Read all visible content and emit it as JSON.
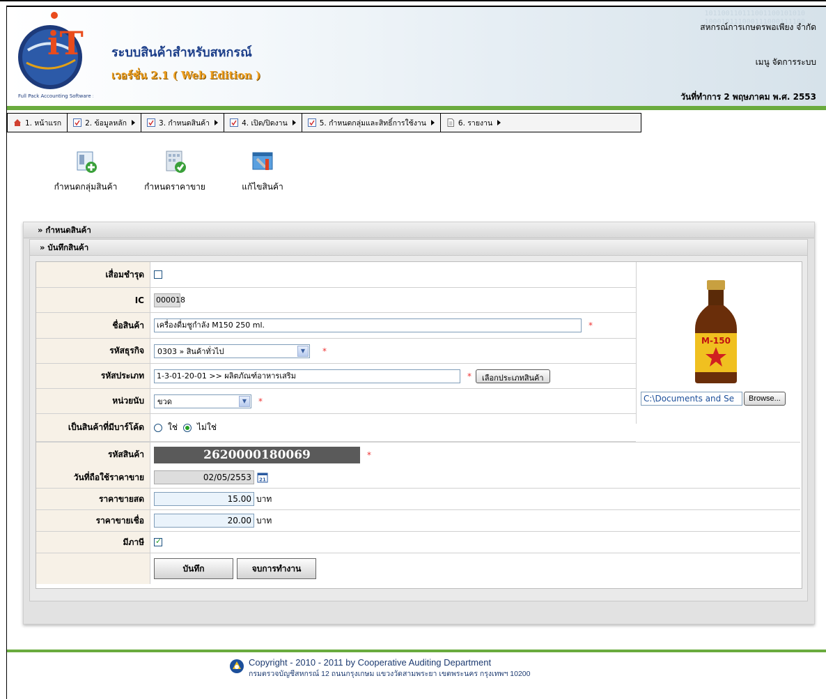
{
  "header": {
    "system_title": "ระบบสินค้าสำหรับสหกรณ์",
    "version": "เวอร์ชั่น 2.1 ( Web Edition )",
    "logo_text": "Full Pack Accounting Software : FAS",
    "coop_name": "สหกรณ์การเกษตรพอเพียง จำกัด",
    "admin_menu": "เมนู จัดการระบบ",
    "working_date": "วันที่ทำการ 2 พฤษภาคม พ.ศ. 2553",
    "binary_text": [
      "101100110111001100101010",
      "100010111000111000111100",
      "10001000111000"
    ]
  },
  "menu": [
    {
      "label": "1. หน้าแรก",
      "icon": "home-icon",
      "arrow": false
    },
    {
      "label": "2. ข้อมูลหลัก",
      "icon": "checklist-icon",
      "arrow": true
    },
    {
      "label": "3. กำหนดสินค้า",
      "icon": "checklist-icon",
      "arrow": true
    },
    {
      "label": "4. เปิด/ปิดงาน",
      "icon": "checklist-icon",
      "arrow": true
    },
    {
      "label": "5. กำหนดกลุ่มและสิทธิ์การใช้งาน",
      "icon": "checklist-icon",
      "arrow": true
    },
    {
      "label": "6. รายงาน",
      "icon": "document-icon",
      "arrow": true
    }
  ],
  "toolbar": {
    "define_group": "กำหนดกลุ่มสินค้า",
    "define_price": "กำหนดราคาขาย",
    "edit_product": "แก้ไขสินค้า"
  },
  "panel": {
    "title": "» กำหนดสินค้า",
    "subtitle": "» บันทึกสินค้า"
  },
  "form": {
    "damaged_label": "เสื่อมชำรุด",
    "damaged_checked": false,
    "ic_label": "IC",
    "ic_value": "000018",
    "name_label": "ชื่อสินค้า",
    "name_value": "เครื่องดื่มชูกำลัง M150 250 ml.",
    "business_label": "รหัสธุรกิจ",
    "business_value": "0303 » สินค้าทั่วไป",
    "type_label": "รหัสประเภท",
    "type_value": "1-3-01-20-01  >> ผลิตภัณฑ์อาหารเสริม",
    "type_button": "เลือกประเภทสินค้า",
    "unit_label": "หน่วยนับ",
    "unit_value": "ขวด",
    "barcode_q_label": "เป็นสินค้าที่มีบาร์โค้ด",
    "barcode_yes": "ใช่",
    "barcode_no": "ไม่ใช่",
    "barcode_selected": "no",
    "code_label": "รหัสสินค้า",
    "code_value": "2620000180069",
    "date_label": "วันที่ถือใช้ราคาขาย",
    "date_value": "02/05/2553",
    "cash_label": "ราคาขายสด",
    "cash_value": "15.00",
    "credit_label": "ราคาขายเชื่อ",
    "credit_value": "20.00",
    "currency": "บาท",
    "tax_label": "มีภาษี",
    "tax_checked": true,
    "required_mark": "*",
    "file_path": "C:\\Documents and Se",
    "browse_button": "Browse...",
    "image_text": "M-150",
    "save_button": "บันทึก",
    "exit_button": "จบการทำงาน",
    "calendar_day": "21"
  },
  "footer": {
    "copyright": "Copyright - 2010 - 2011  by Cooperative Auditing Department",
    "address": "กรมตรวจบัญชีสหกรณ์ 12 ถนนกรุงเกษม แขวงวัดสามพระยา เขตพระนคร กรุงเทพฯ 10200"
  },
  "colors": {
    "accent_green": "#6aab3e",
    "title_blue": "#1d3f8a",
    "version_orange": "#f0a020",
    "label_bg": "#f7f1e7"
  }
}
